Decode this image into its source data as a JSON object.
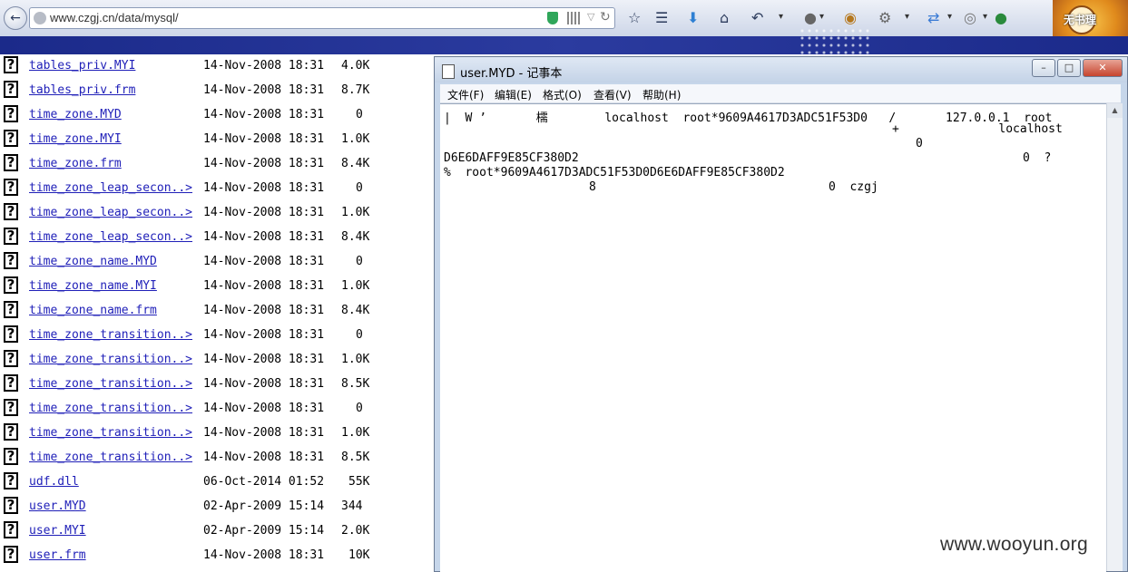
{
  "browser": {
    "url": "www.czgj.cn/data/mysql/",
    "user_name": "无书理"
  },
  "listing": {
    "rows": [
      {
        "name": "tables_priv.MYI",
        "date": "14-Nov-2008 18:31",
        "size": "4.0K"
      },
      {
        "name": "tables_priv.frm",
        "date": "14-Nov-2008 18:31",
        "size": "8.7K"
      },
      {
        "name": "time_zone.MYD",
        "date": "14-Nov-2008 18:31",
        "size": "0"
      },
      {
        "name": "time_zone.MYI",
        "date": "14-Nov-2008 18:31",
        "size": "1.0K"
      },
      {
        "name": "time_zone.frm",
        "date": "14-Nov-2008 18:31",
        "size": "8.4K"
      },
      {
        "name": "time_zone_leap_secon..>",
        "date": "14-Nov-2008 18:31",
        "size": "0"
      },
      {
        "name": "time_zone_leap_secon..>",
        "date": "14-Nov-2008 18:31",
        "size": "1.0K"
      },
      {
        "name": "time_zone_leap_secon..>",
        "date": "14-Nov-2008 18:31",
        "size": "8.4K"
      },
      {
        "name": "time_zone_name.MYD",
        "date": "14-Nov-2008 18:31",
        "size": "0"
      },
      {
        "name": "time_zone_name.MYI",
        "date": "14-Nov-2008 18:31",
        "size": "1.0K"
      },
      {
        "name": "time_zone_name.frm",
        "date": "14-Nov-2008 18:31",
        "size": "8.4K"
      },
      {
        "name": "time_zone_transition..>",
        "date": "14-Nov-2008 18:31",
        "size": "0"
      },
      {
        "name": "time_zone_transition..>",
        "date": "14-Nov-2008 18:31",
        "size": "1.0K"
      },
      {
        "name": "time_zone_transition..>",
        "date": "14-Nov-2008 18:31",
        "size": "8.5K"
      },
      {
        "name": "time_zone_transition..>",
        "date": "14-Nov-2008 18:31",
        "size": "0"
      },
      {
        "name": "time_zone_transition..>",
        "date": "14-Nov-2008 18:31",
        "size": "1.0K"
      },
      {
        "name": "time_zone_transition..>",
        "date": "14-Nov-2008 18:31",
        "size": "8.5K"
      },
      {
        "name": "udf.dll",
        "date": "06-Oct-2014 01:52",
        "size": "55K"
      },
      {
        "name": "user.MYD",
        "date": "02-Apr-2009 15:14",
        "size": "344"
      },
      {
        "name": "user.MYI",
        "date": "02-Apr-2009 15:14",
        "size": "2.0K"
      },
      {
        "name": "user.frm",
        "date": "14-Nov-2008 18:31",
        "size": "10K"
      }
    ]
  },
  "notepad": {
    "title": "user.MYD - 记事本",
    "menu": [
      "文件(F)",
      "编辑(E)",
      "格式(O)",
      "查看(V)",
      "帮助(H)"
    ],
    "content": [
      "|  W ’       檽        localhost  root*9609A4617D3ADC51F53D0   /       127.0.0.1  root",
      "+              localhost",
      "0",
      "D6E6DAFF9E85CF380D2",
      "0  ?",
      "%  root*9609A4617D3ADC51F53D0D6E6DAFF9E85CF380D2",
      "8",
      "0  czgj"
    ]
  },
  "watermark": "www.wooyun.org"
}
